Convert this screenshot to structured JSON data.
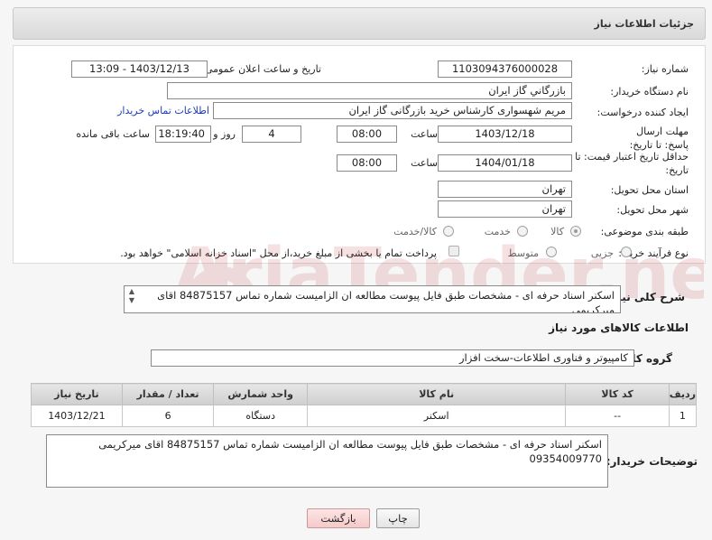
{
  "header": {
    "title": "جزئیات اطلاعات نیاز"
  },
  "form": {
    "need_number": {
      "label": "شماره نیاز:",
      "value": "1103094376000028"
    },
    "announce_datetime": {
      "label": "تاریخ و ساعت اعلان عمومی:",
      "value": "1403/12/13 - 13:09"
    },
    "buyer_org": {
      "label": "نام دستگاه خریدار:",
      "value": "بازرگاني گاز ایران"
    },
    "requester": {
      "label": "ایجاد کننده درخواست:",
      "value": "مریم شهسواری کارشناس خرید بازرگانی گاز ایران",
      "contact_link": "اطلاعات تماس خریدار"
    },
    "reply_deadline": {
      "label": "مهلت ارسال پاسخ: تا تاریخ:",
      "date": "1403/12/18",
      "time_label": "ساعت",
      "time": "08:00",
      "days": "4",
      "days_label": "روز و",
      "remaining": "18:19:40",
      "remaining_label": "ساعت باقی مانده"
    },
    "price_validity": {
      "label": "حداقل تاریخ اعتبار قیمت: تا تاریخ:",
      "date": "1404/01/18",
      "time_label": "ساعت",
      "time": "08:00"
    },
    "province": {
      "label": "استان محل تحویل:",
      "value": "تهران"
    },
    "city": {
      "label": "شهر محل تحویل:",
      "value": "تهران"
    },
    "category": {
      "label": "طبقه بندی موضوعی:",
      "options": [
        "کالا",
        "خدمت",
        "کالا/خدمت"
      ],
      "selected": "کالا"
    },
    "process_type": {
      "label": "نوع فرآیند خرید :",
      "options": [
        "جزیی",
        "متوسط"
      ],
      "payment_note": "پرداخت تمام یا بخشی از مبلغ خرید،از محل \"اسناد خزانه اسلامی\" خواهد بود."
    }
  },
  "summary": {
    "label": "شرح کلی نیاز:",
    "value": "اسکنر اسناد حرفه ای  - مشخصات طبق فایل پیوست مطالعه ان الزامیست شماره تماس 84875157 اقای میرکریمی"
  },
  "goods_section": {
    "title": "اطلاعات کالاهای مورد نیاز",
    "group_label": "گروه کالا:",
    "group_value": "کامپیوتر و فناوری اطلاعات-سخت افزار"
  },
  "table": {
    "headers": [
      "ردیف",
      "کد کالا",
      "نام کالا",
      "واحد شمارش",
      "تعداد / مقدار",
      "تاریخ نیاز"
    ],
    "rows": [
      [
        "1",
        "--",
        "اسکنر",
        "دستگاه",
        "6",
        "1403/12/21"
      ]
    ]
  },
  "buyer_notes": {
    "label": "توضیحات خریدار:",
    "value": "اسکنر اسناد حرفه ای  - مشخصات طبق فایل پیوست مطالعه ان الزامیست شماره تماس 84875157 اقای میرکریمی 09354009770"
  },
  "buttons": {
    "print": "چاپ",
    "back": "بازگشت"
  },
  "watermark": {
    "text": "AriaTender.neT"
  },
  "colors": {
    "link": "#1a3db8",
    "back_button": "#f5caca"
  }
}
